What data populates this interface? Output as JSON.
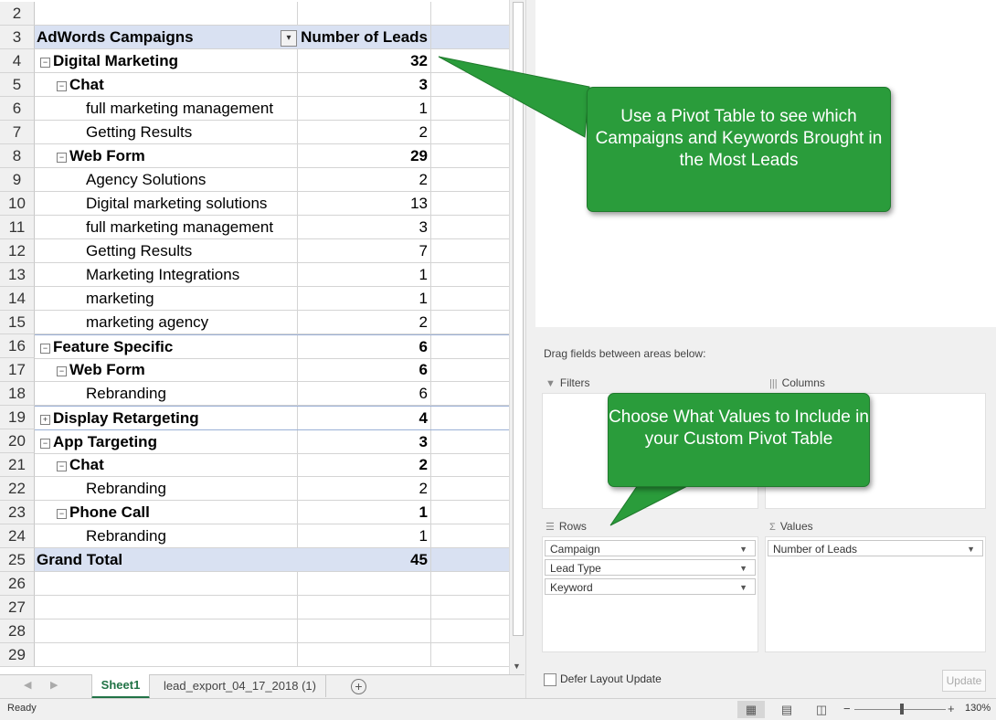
{
  "pivot": {
    "header_label": "AdWords Campaigns",
    "header_value": "Number of Leads",
    "rows": [
      {
        "num": "2",
        "label": "",
        "value": "",
        "type": "empty"
      },
      {
        "num": "3",
        "label": "AdWords Campaigns",
        "value": "Number of Leads",
        "type": "header"
      },
      {
        "num": "4",
        "label": "Digital Marketing",
        "value": "32",
        "type": "l1",
        "toggle": "−"
      },
      {
        "num": "5",
        "label": "Chat",
        "value": "3",
        "type": "l2",
        "toggle": "−"
      },
      {
        "num": "6",
        "label": "full marketing management",
        "value": "1",
        "type": "l3"
      },
      {
        "num": "7",
        "label": "Getting Results",
        "value": "2",
        "type": "l3"
      },
      {
        "num": "8",
        "label": "Web Form",
        "value": "29",
        "type": "l2",
        "toggle": "−"
      },
      {
        "num": "9",
        "label": "Agency Solutions",
        "value": "2",
        "type": "l3"
      },
      {
        "num": "10",
        "label": "Digital marketing solutions",
        "value": "13",
        "type": "l3"
      },
      {
        "num": "11",
        "label": "full marketing management",
        "value": "3",
        "type": "l3"
      },
      {
        "num": "12",
        "label": "Getting Results",
        "value": "7",
        "type": "l3"
      },
      {
        "num": "13",
        "label": "Marketing Integrations",
        "value": "1",
        "type": "l3"
      },
      {
        "num": "14",
        "label": "marketing",
        "value": "1",
        "type": "l3"
      },
      {
        "num": "15",
        "label": "marketing agency",
        "value": "2",
        "type": "l3"
      },
      {
        "num": "16",
        "label": "Feature Specific",
        "value": "6",
        "type": "l1",
        "toggle": "−"
      },
      {
        "num": "17",
        "label": "Web Form",
        "value": "6",
        "type": "l2",
        "toggle": "−"
      },
      {
        "num": "18",
        "label": "Rebranding",
        "value": "6",
        "type": "l3"
      },
      {
        "num": "19",
        "label": "Display Retargeting",
        "value": "4",
        "type": "l1",
        "toggle": "+"
      },
      {
        "num": "20",
        "label": "App Targeting",
        "value": "3",
        "type": "l1",
        "toggle": "−"
      },
      {
        "num": "21",
        "label": "Chat",
        "value": "2",
        "type": "l2",
        "toggle": "−"
      },
      {
        "num": "22",
        "label": "Rebranding",
        "value": "2",
        "type": "l3"
      },
      {
        "num": "23",
        "label": "Phone Call",
        "value": "1",
        "type": "l2",
        "toggle": "−"
      },
      {
        "num": "24",
        "label": "Rebranding",
        "value": "1",
        "type": "l3"
      },
      {
        "num": "25",
        "label": "Grand Total",
        "value": "45",
        "type": "total"
      },
      {
        "num": "26",
        "label": "",
        "value": "",
        "type": "empty"
      },
      {
        "num": "27",
        "label": "",
        "value": "",
        "type": "empty"
      },
      {
        "num": "28",
        "label": "",
        "value": "",
        "type": "empty"
      },
      {
        "num": "29",
        "label": "",
        "value": "",
        "type": "empty"
      }
    ]
  },
  "tabs": {
    "active": "Sheet1",
    "other": "lead_export_04_17_2018 (1)"
  },
  "pane": {
    "drag_hint": "Drag fields between areas below:",
    "filters_label": "Filters",
    "columns_label": "Columns",
    "rows_label": "Rows",
    "values_label": "Values",
    "rows_fields": [
      "Campaign",
      "Lead Type",
      "Keyword"
    ],
    "values_fields": [
      "Number of Leads"
    ],
    "defer_label": "Defer Layout Update",
    "update_label": "Update"
  },
  "status": {
    "ready": "Ready",
    "zoom": "130%"
  },
  "callouts": {
    "top": "Use a Pivot Table to see which Campaigns and Keywords Brought in the Most Leads",
    "bottom": "Choose What Values to Include in your Custom Pivot Table"
  },
  "colors": {
    "header_fill": "#d9e1f2",
    "accent_green": "#217346",
    "callout_green": "#2a9c3b"
  }
}
